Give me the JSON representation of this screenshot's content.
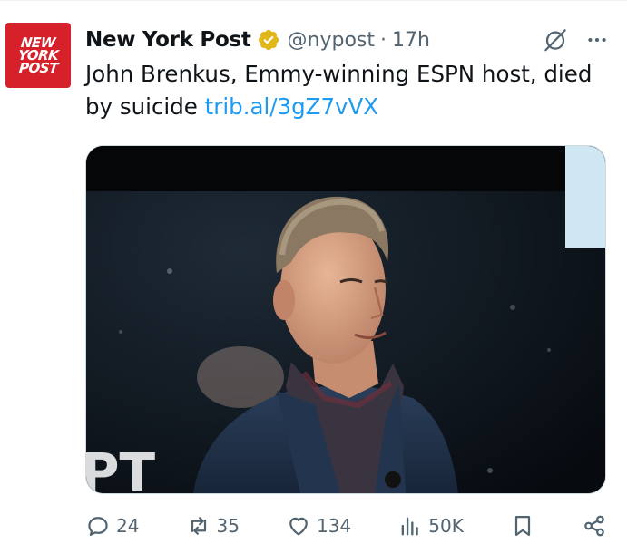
{
  "tweet": {
    "author_name": "New York Post",
    "handle": "@nypost",
    "separator": "·",
    "time": "17h",
    "avatar": {
      "lines": [
        "NEW",
        "YORK",
        "POST"
      ],
      "color": "#d6202a"
    },
    "verified_badge_color": "#e2b719",
    "text_prefix": "John Brenkus, Emmy-winning ESPN host, died by suicide",
    "link": "trib.al/3gZ7vVX",
    "media": {
      "icons": [
        "person-photo"
      ]
    }
  },
  "actions": {
    "reply_count": "24",
    "retweet_count": "35",
    "like_count": "134",
    "views_count": "50K"
  },
  "icons": {
    "grok": "grok-icon",
    "more": "more-icon",
    "reply": "reply-icon",
    "retweet": "retweet-icon",
    "like": "heart-icon",
    "views": "views-icon",
    "bookmark": "bookmark-icon",
    "share": "share-icon"
  },
  "colors": {
    "link": "#1d9bf0",
    "secondary_text": "#536471",
    "primary_text": "#0f1419"
  }
}
